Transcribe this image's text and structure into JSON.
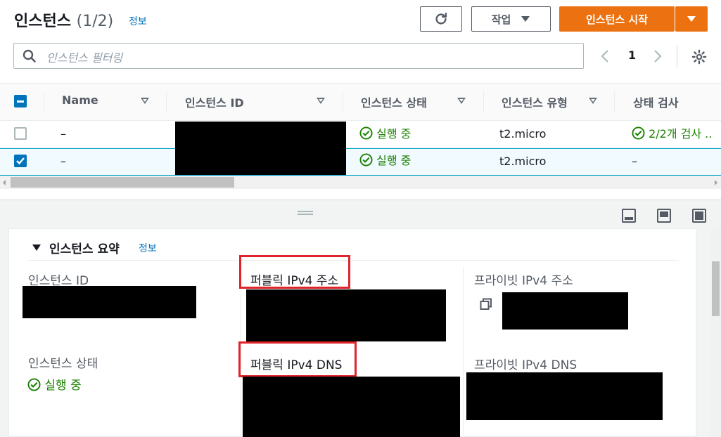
{
  "header": {
    "title": "인스턴스",
    "count": "(1/2)",
    "info": "정보",
    "actions_label": "작업",
    "launch_label": "인스턴스 시작"
  },
  "search": {
    "placeholder": "인스턴스 필터링"
  },
  "pager": {
    "page": "1"
  },
  "table": {
    "columns": [
      "Name",
      "인스턴스 ID",
      "인스턴스 상태",
      "인스턴스 유형",
      "상태 검사"
    ],
    "rows": [
      {
        "name": "–",
        "state": "실행 중",
        "type": "t2.micro",
        "check": "2/2개 검사 ..",
        "selected": false
      },
      {
        "name": "–",
        "state": "실행 중",
        "type": "t2.micro",
        "check": "–",
        "selected": true
      }
    ]
  },
  "summary": {
    "heading": "인스턴스 요약",
    "info": "정보",
    "instance_id_label": "인스턴스 ID",
    "public_ipv4_label": "퍼블릭 IPv4 주소",
    "private_ipv4_label": "프라이빗 IPv4 주소",
    "instance_state_label": "인스턴스 상태",
    "instance_state_value": "실행 중",
    "public_dns_label": "퍼블릭 IPv4 DNS",
    "private_dns_label": "프라이빗 IPv4 DNS"
  },
  "colors": {
    "accent": "#ec7211",
    "link": "#0073bb",
    "success": "#1d8102",
    "highlight": "#e0242a"
  }
}
